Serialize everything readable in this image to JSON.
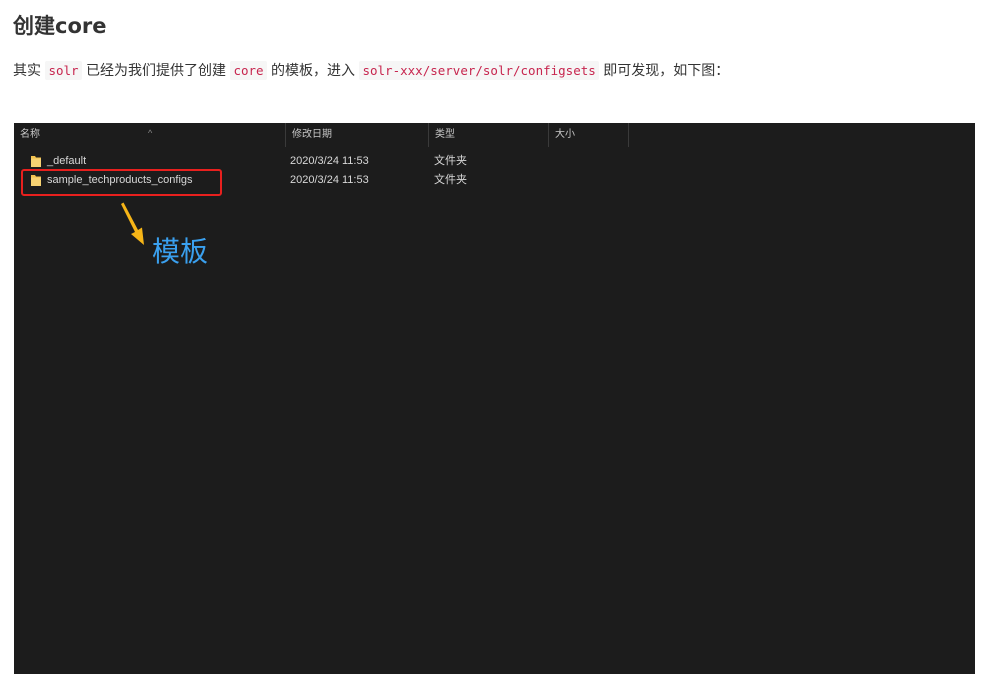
{
  "heading": "创建core",
  "paragraph": {
    "t1": "其实 ",
    "code1": "solr",
    "t2": " 已经为我们提供了创建 ",
    "code2": "core",
    "t3": " 的模板，进入 ",
    "code3": "solr-xxx/server/solr/configsets",
    "t4": " 即可发现，如下图："
  },
  "explorer": {
    "columns": {
      "name": "名称",
      "modified": "修改日期",
      "type": "类型",
      "size": "大小"
    },
    "rows": [
      {
        "name": "_default",
        "modified": "2020/3/24 11:53",
        "type": "文件夹",
        "icon": "folder-icon"
      },
      {
        "name": "sample_techproducts_configs",
        "modified": "2020/3/24 11:53",
        "type": "文件夹",
        "icon": "folder-icon"
      }
    ],
    "colors": {
      "background": "#1c1c1c",
      "folder": "#f2c24f",
      "highlight": "#e8201e",
      "arrow": "#f6b517",
      "annotation": "#3aa0ef"
    }
  },
  "annotation": "模板"
}
